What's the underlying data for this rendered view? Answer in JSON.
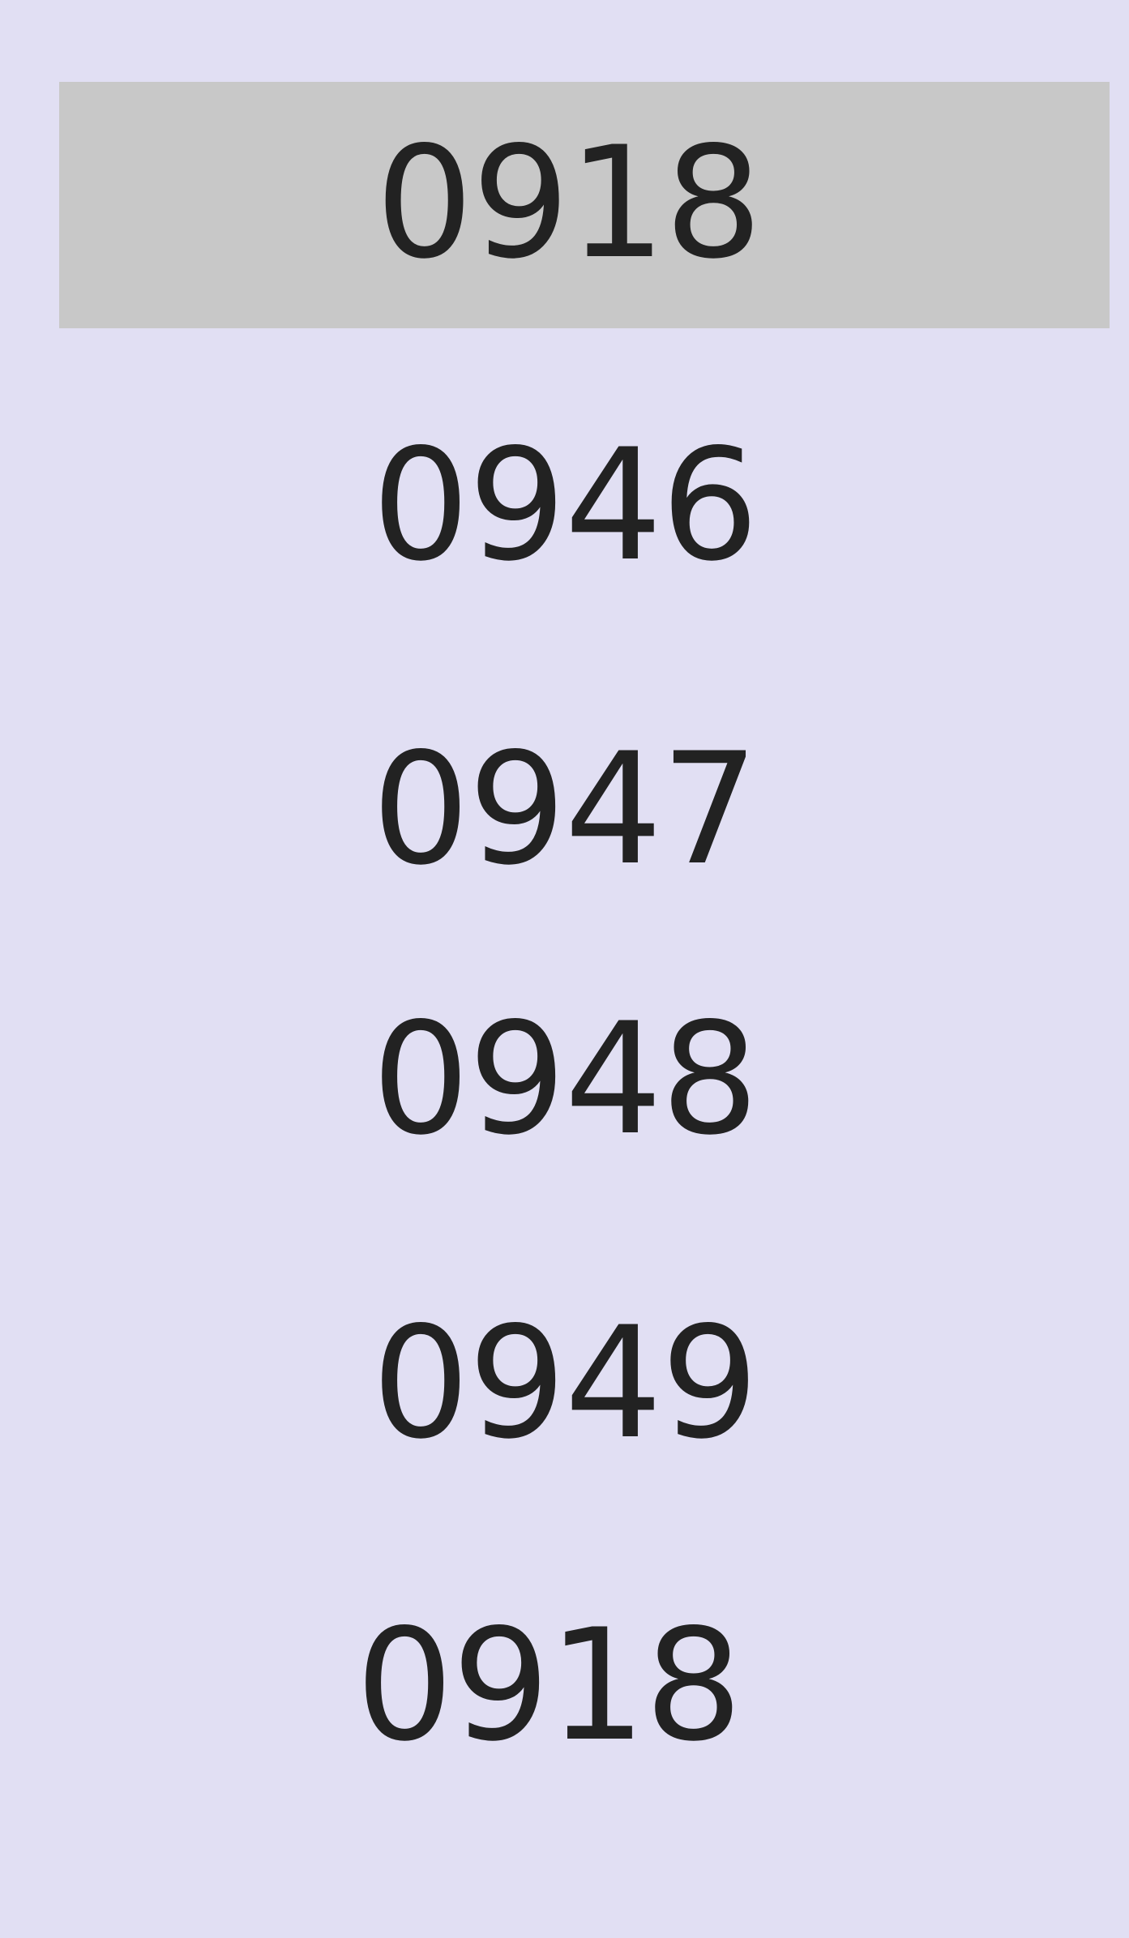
{
  "list": {
    "items": [
      {
        "label": "0918",
        "selected": true
      },
      {
        "label": "0946",
        "selected": false
      },
      {
        "label": "0947",
        "selected": false
      },
      {
        "label": "0948",
        "selected": false
      },
      {
        "label": "0949",
        "selected": false
      },
      {
        "label": "0918",
        "selected": false
      }
    ]
  },
  "colors": {
    "background": "#e1dff3",
    "selected_background": "#c8c8c8",
    "text": "#222222"
  }
}
